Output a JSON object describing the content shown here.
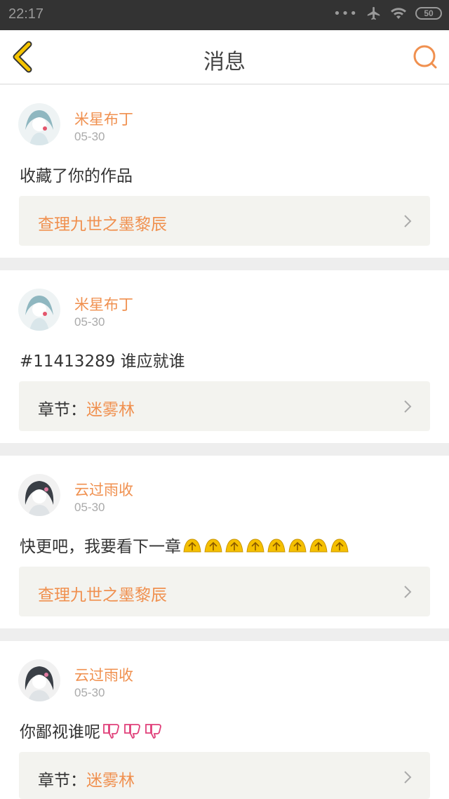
{
  "status_bar": {
    "time": "22:17",
    "battery": "50",
    "icons": [
      "more-dots-icon",
      "airplane-icon",
      "wifi-icon",
      "battery-icon"
    ]
  },
  "header": {
    "title": "消息",
    "back_icon": "chevron-left-icon",
    "search_icon": "search-icon",
    "accent_color": "#f0904f"
  },
  "messages": [
    {
      "username": "米星布丁",
      "date": "05-30",
      "text": "收藏了你的作品",
      "link_prefix": "",
      "link_text": "查理九世之墨黎辰",
      "emoji": ""
    },
    {
      "username": "米星布丁",
      "date": "05-30",
      "text": "#11413289 谁应就谁",
      "link_prefix": "章节：",
      "link_text": "迷雾林",
      "emoji": ""
    },
    {
      "username": "云过雨收",
      "date": "05-30",
      "text": "快更吧，我要看下一章",
      "link_prefix": "",
      "link_text": "查理九世之墨黎辰",
      "emoji": "pray-emoji",
      "emoji_count": 8
    },
    {
      "username": "云过雨收",
      "date": "05-30",
      "text": "你鄙视谁呢",
      "link_prefix": "章节：",
      "link_text": "迷雾林",
      "emoji": "thumbs-down-emoji",
      "emoji_count": 3
    }
  ]
}
